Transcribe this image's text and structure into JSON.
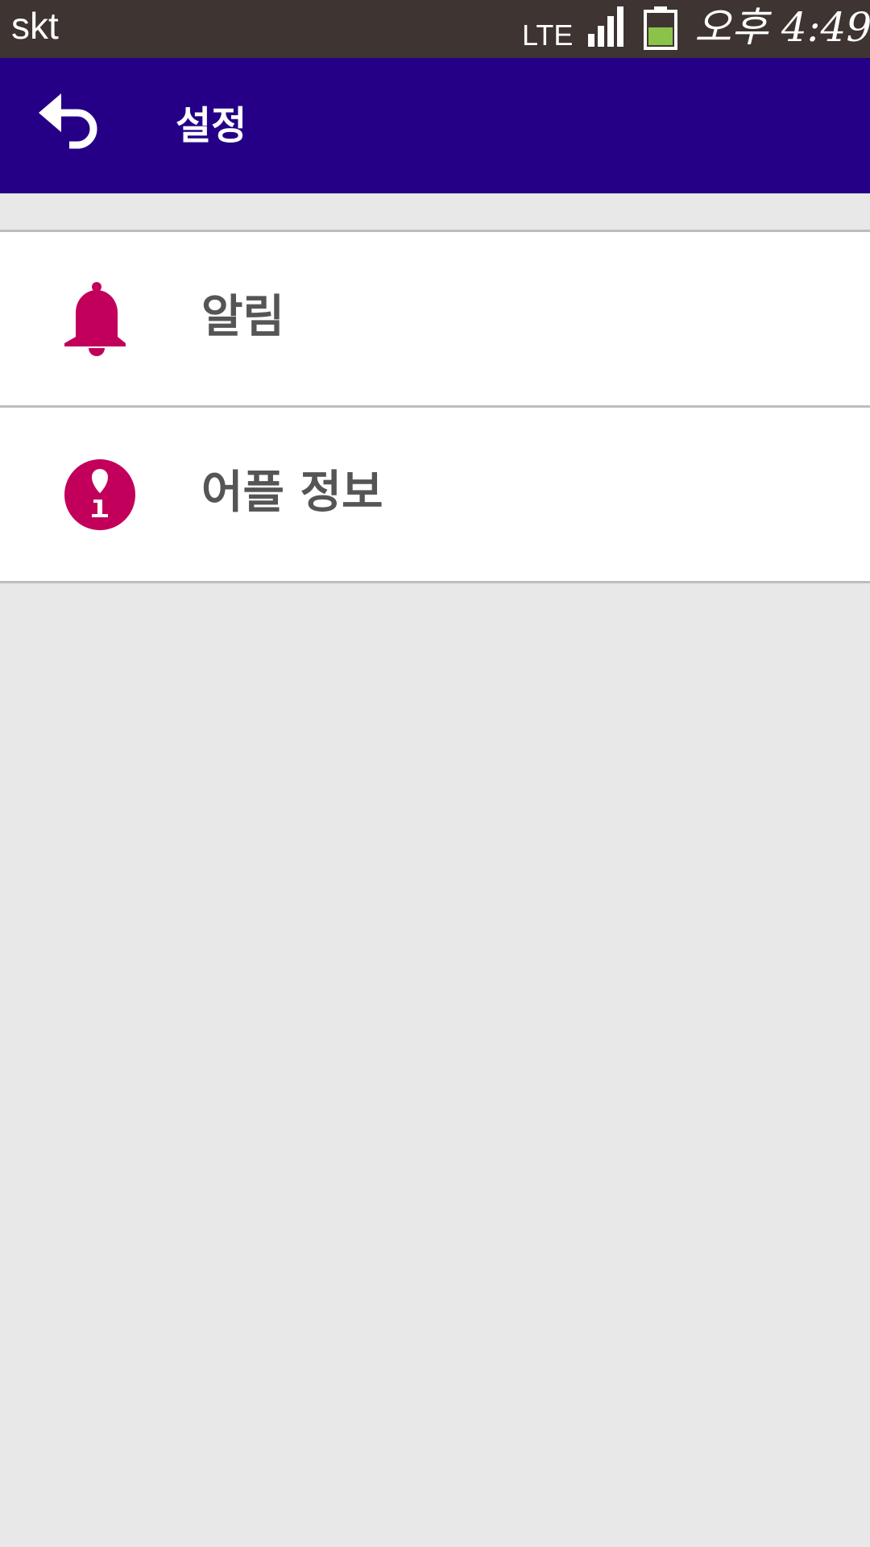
{
  "status_bar": {
    "carrier": "skt",
    "network": "LTE",
    "time": "오후 4:49",
    "battery_color": "#8bc34a"
  },
  "app_bar": {
    "title": "설정",
    "back_icon": "back-arrow-icon",
    "background": "#250087"
  },
  "menu": {
    "items": [
      {
        "label": "알림",
        "icon": "bell-icon",
        "icon_color": "#c2005c"
      },
      {
        "label": "어플 정보",
        "icon": "info-icon",
        "icon_color": "#c2005c"
      }
    ]
  }
}
